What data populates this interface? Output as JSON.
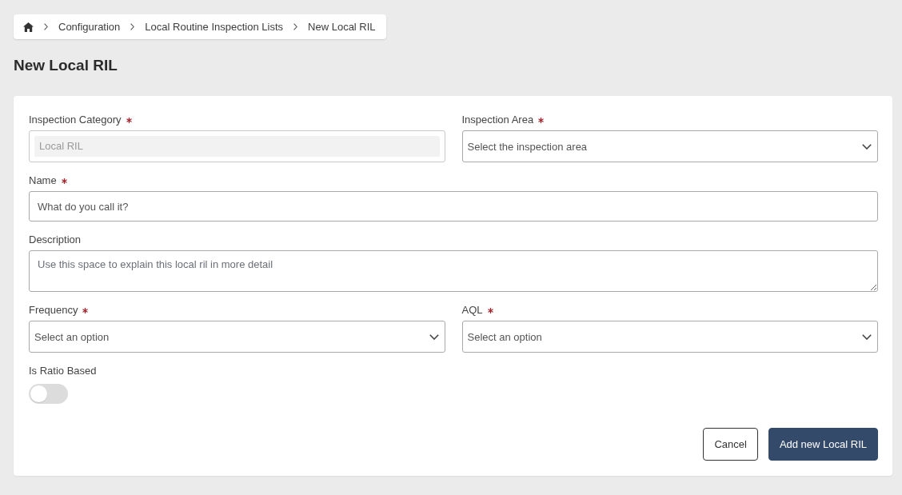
{
  "breadcrumb": [
    "Configuration",
    "Local Routine Inspection Lists",
    "New Local RIL"
  ],
  "page_title": "New Local RIL",
  "form": {
    "rows": [
      {
        "fields": [
          {
            "kind": "readonly",
            "label": "Inspection Category",
            "required": true,
            "disabled": true,
            "value": "Local RIL"
          },
          {
            "kind": "select",
            "label": "Inspection Area",
            "required": true,
            "placeholder": "Select the inspection area"
          }
        ]
      },
      {
        "fields": [
          {
            "kind": "text",
            "label": "Name",
            "required": true,
            "placeholder": "What do you call it?"
          }
        ]
      },
      {
        "fields": [
          {
            "kind": "textarea",
            "label": "Description",
            "required": false,
            "placeholder": "Use this space to explain this local ril in more detail"
          }
        ]
      },
      {
        "fields": [
          {
            "kind": "select",
            "label": "Frequency",
            "required": true,
            "placeholder": "Select an option"
          },
          {
            "kind": "select",
            "label": "AQL",
            "required": true,
            "placeholder": "Select an option"
          }
        ]
      },
      {
        "fields": [
          {
            "kind": "toggle",
            "label": "Is Ratio Based",
            "required": false,
            "on": false
          }
        ]
      }
    ],
    "buttons": [
      {
        "kind": "secondary",
        "label": "Cancel"
      },
      {
        "kind": "primary",
        "label": "Add new Local RIL"
      }
    ]
  }
}
